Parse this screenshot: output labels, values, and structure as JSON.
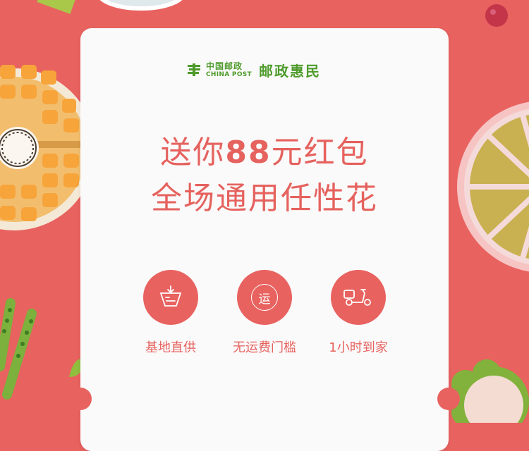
{
  "brand": {
    "name_cn": "中国邮政",
    "name_en": "CHINA POST",
    "slogan": "邮政惠民",
    "color": "#4e9b2c"
  },
  "headline": {
    "line1_prefix": "送你",
    "line1_amount": "88",
    "line1_suffix": "元红包",
    "line2": "全场通用任性花",
    "color": "#e5625e"
  },
  "features": [
    {
      "icon": "basket-icon",
      "label": "基地直供"
    },
    {
      "icon": "shipping-icon",
      "icon_text": "运",
      "label": "无运费门槛"
    },
    {
      "icon": "scooter-icon",
      "label": "1小时到家"
    }
  ],
  "colors": {
    "background": "#e8625f",
    "card": "#fbfafa",
    "accent": "#e8625f"
  }
}
